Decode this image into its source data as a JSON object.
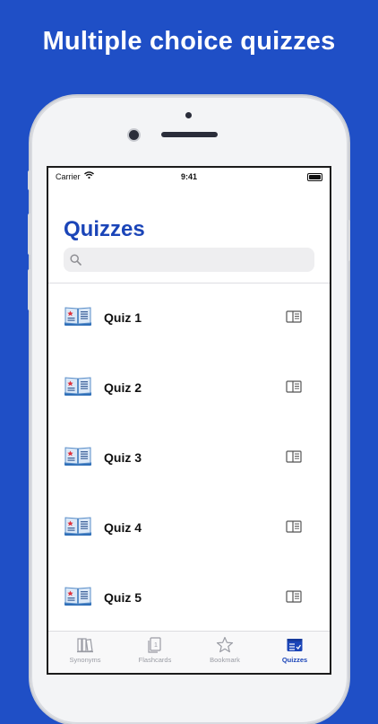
{
  "headline": "Multiple choice quizzes",
  "status_bar": {
    "carrier": "Carrier",
    "time": "9:41"
  },
  "page": {
    "title": "Quizzes"
  },
  "search": {
    "placeholder": ""
  },
  "quizzes": [
    {
      "label": "Quiz 1"
    },
    {
      "label": "Quiz 2"
    },
    {
      "label": "Quiz 3"
    },
    {
      "label": "Quiz 4"
    },
    {
      "label": "Quiz 5"
    }
  ],
  "tabbar": {
    "items": [
      {
        "label": "Synonyms",
        "icon": "books-icon",
        "active": false
      },
      {
        "label": "Flashcards",
        "icon": "flashcard-icon",
        "active": false
      },
      {
        "label": "Bookmark",
        "icon": "star-icon",
        "active": false
      },
      {
        "label": "Quizzes",
        "icon": "quiz-list-icon",
        "active": true
      }
    ]
  },
  "colors": {
    "background": "#1f4fc6",
    "accent": "#1b45b8",
    "inactive": "#9a9ca4"
  }
}
